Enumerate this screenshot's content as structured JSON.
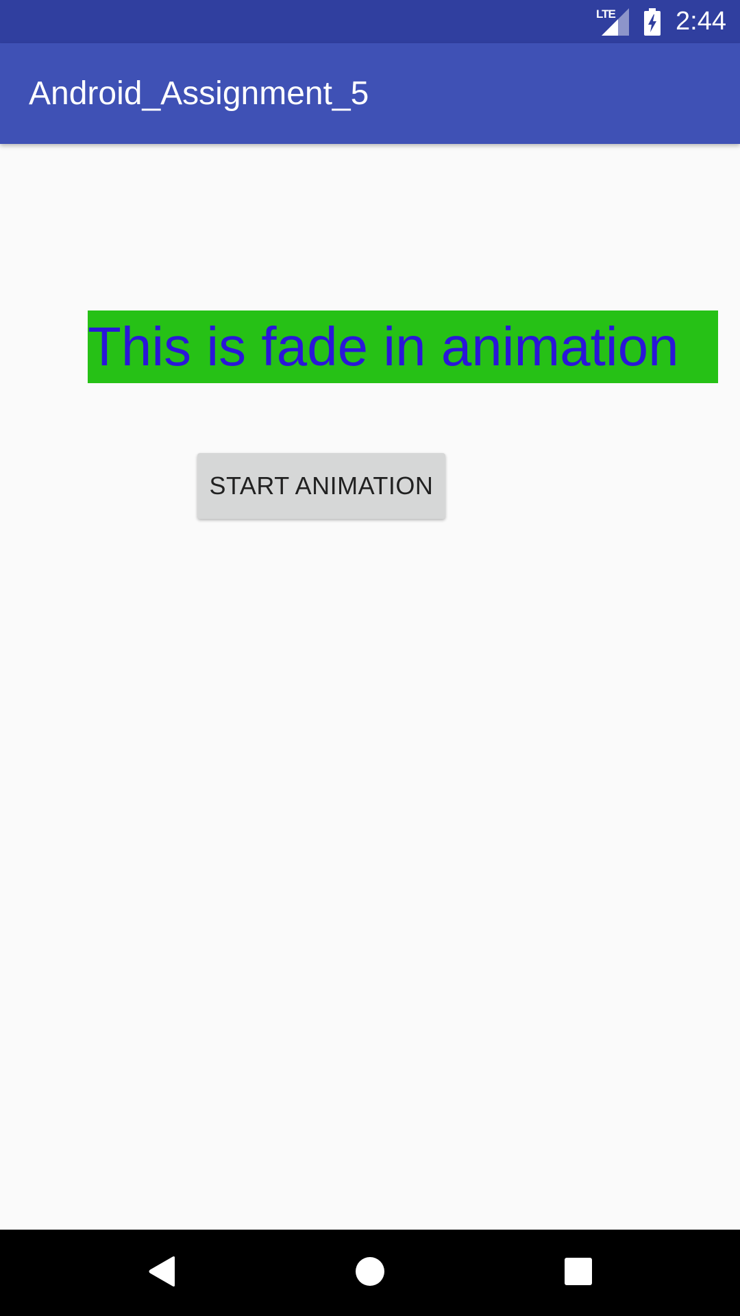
{
  "status_bar": {
    "network_label": "LTE",
    "time": "2:44",
    "icons": [
      "lte-signal-icon",
      "battery-charging-icon"
    ],
    "background": "#303f9f"
  },
  "app_bar": {
    "title": "Android_Assignment_5",
    "background": "#3f51b5"
  },
  "main": {
    "animated_text": "This is fade in animation",
    "animated_text_color": "#2a16d9",
    "animated_text_background": "#26c116",
    "start_button_label": "START ANIMATION"
  },
  "nav_bar": {
    "icons": [
      "back-icon",
      "home-icon",
      "recents-icon"
    ]
  }
}
